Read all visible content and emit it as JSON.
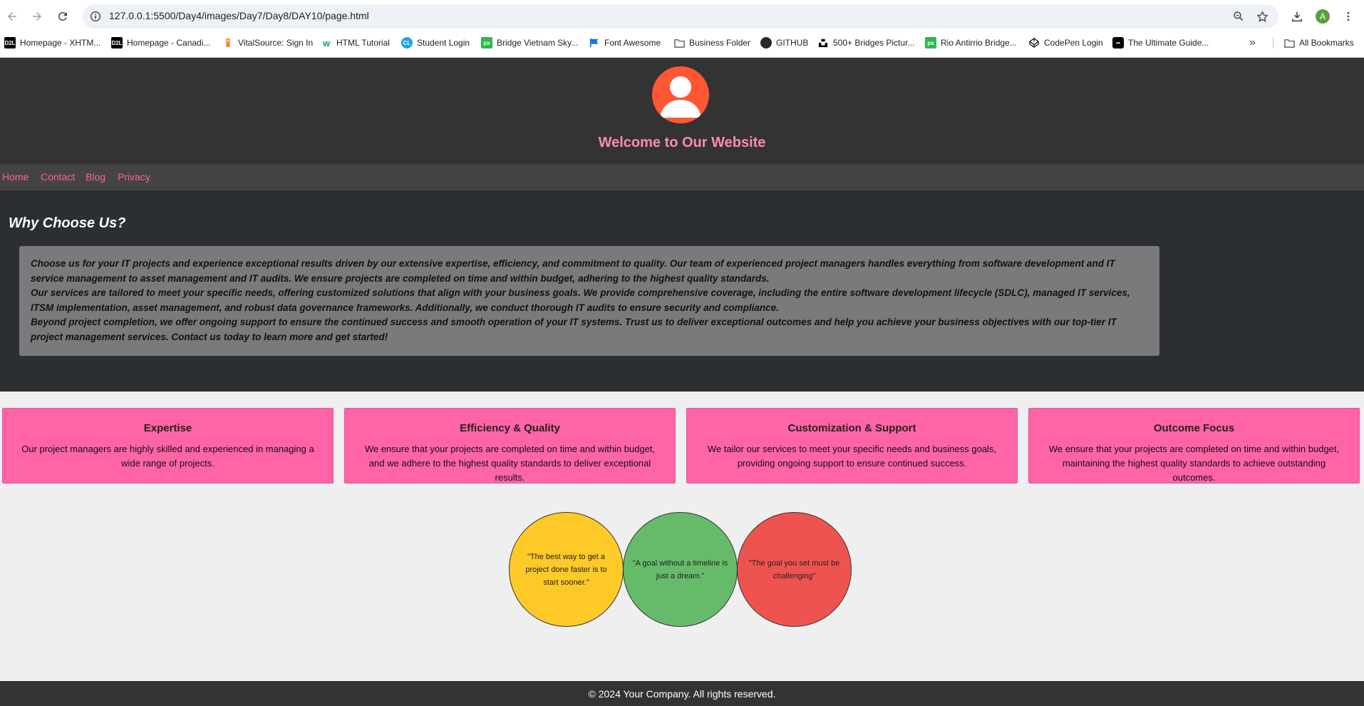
{
  "browser": {
    "url": "127.0.0.1:5500/Day4/images/Day7/Day8/DAY10/page.html",
    "profile_initial": "A",
    "bookmarks": [
      {
        "label": "Homepage - XHTM...",
        "icon_text": "D2L",
        "icon_color": "#000000"
      },
      {
        "label": "Homepage - Canadi...",
        "icon_text": "D2L",
        "icon_color": "#000000"
      },
      {
        "label": "VitalSource: Sign In",
        "icon_text": "",
        "icon_color": "#f08a24"
      },
      {
        "label": "HTML Tutorial",
        "icon_text": "w",
        "icon_color": "#04aa6d"
      },
      {
        "label": "Student Login",
        "icon_text": "CL",
        "icon_color": "#1aa3e8"
      },
      {
        "label": "Bridge Vietnam Sky...",
        "icon_text": "px",
        "icon_color": "#2fb84a"
      },
      {
        "label": "Font Awesome",
        "icon_text": "",
        "icon_color": "#1c6fe8"
      },
      {
        "label": "Business Folder",
        "icon_text": "",
        "icon_color": "folder"
      },
      {
        "label": "GITHUB",
        "icon_text": "",
        "icon_color": "#24292f"
      },
      {
        "label": "500+ Bridges Pictur...",
        "icon_text": "",
        "icon_color": "#000000"
      },
      {
        "label": "Rio Antirrio Bridge...",
        "icon_text": "px",
        "icon_color": "#2fb84a"
      },
      {
        "label": "CodePen Login",
        "icon_text": "",
        "icon_color": "#000000"
      },
      {
        "label": "The Ultimate Guide...",
        "icon_text": "••",
        "icon_color": "#000000"
      }
    ],
    "all_bookmarks_label": "All Bookmarks",
    "overflow_label": "»"
  },
  "header": {
    "title": "Welcome to Our Website",
    "avatar_color": "#ff5733"
  },
  "nav": {
    "items": [
      "Home",
      "Contact",
      "Blog",
      "Privacy"
    ]
  },
  "why": {
    "title": "Why Choose Us?",
    "paragraphs": [
      "Choose us for your IT projects and experience exceptional results driven by our extensive expertise, efficiency, and commitment to quality. Our team of experienced project managers handles everything from software development and IT service management to asset management and IT audits. We ensure projects are completed on time and within budget, adhering to the highest quality standards.",
      "Our services are tailored to meet your specific needs, offering customized solutions that align with your business goals. We provide comprehensive coverage, including the entire software development lifecycle (SDLC), managed IT services, ITSM implementation, asset management, and robust data governance frameworks. Additionally, we conduct thorough IT audits to ensure security and compliance.",
      "Beyond project completion, we offer ongoing support to ensure the continued success and smooth operation of your IT systems. Trust us to deliver exceptional outcomes and help you achieve your business objectives with our top-tier IT project management services. Contact us today to learn more and get started!"
    ]
  },
  "cards": [
    {
      "title": "Expertise",
      "text": "Our project managers are highly skilled and experienced in managing a wide range of projects."
    },
    {
      "title": "Efficiency & Quality",
      "text": "We ensure that your projects are completed on time and within budget, and we adhere to the highest quality standards to deliver exceptional results."
    },
    {
      "title": "Customization & Support",
      "text": "We tailor our services to meet your specific needs and business goals, providing ongoing support to ensure continued success."
    },
    {
      "title": "Outcome Focus",
      "text": "We ensure that your projects are completed on time and within budget, maintaining the highest quality standards to achieve outstanding outcomes."
    }
  ],
  "quotes": [
    {
      "text": "\"The best way to get a project done faster is to start sooner.\"",
      "color": "#ffca28"
    },
    {
      "text": "\"A goal without a timeline is just a dream.\"",
      "color": "#66bb6a"
    },
    {
      "text": "\"The goal you set must be challenging\"",
      "color": "#ef5350"
    }
  ],
  "footer": {
    "text": "© 2024 Your Company. All rights reserved."
  }
}
